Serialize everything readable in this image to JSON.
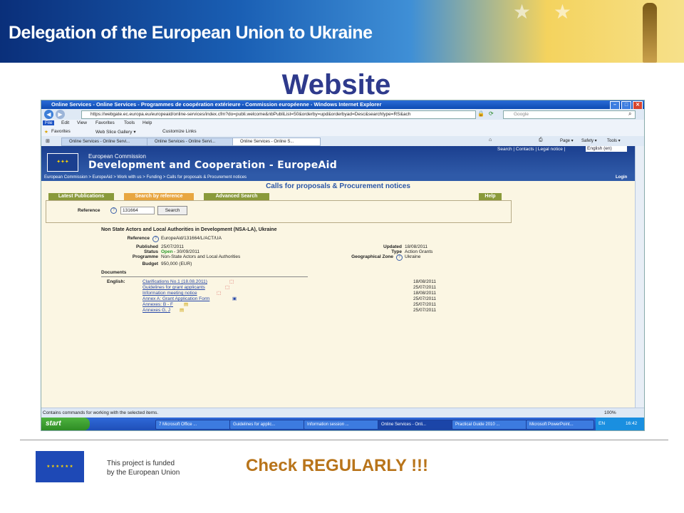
{
  "slide": {
    "banner_title": "Delegation of the European Union to Ukraine",
    "title": "Website",
    "funded_line1": "This project is funded",
    "funded_line2": "by the European Union",
    "callout": "Check REGULARLY !!!"
  },
  "browser": {
    "window_title": "Online Services - Online Services - Programmes de coopération extérieure - Commission européenne - Windows Internet Explorer",
    "url": "https://webgate.ec.europa.eu/europeaid/online-services/index.cfm?do=publi.welcome&nbPubliList=50&orderby=upd&orderbyad=Desc&searchtype=RS&ach",
    "search_placeholder": "Google",
    "menu": [
      "File",
      "Edit",
      "View",
      "Favorites",
      "Tools",
      "Help"
    ],
    "favorites_label": "Favorites",
    "web_slice": "Web Slice Gallery ▾",
    "customize_links": "Customize Links",
    "tabs": [
      "Online Services - Online Servi...",
      "Online Services - Online Servi...",
      "Online Services - Online S..."
    ],
    "commands": [
      "Page ▾",
      "Safety ▾",
      "Tools ▾"
    ],
    "status_text": "Contains commands for working with the selected items.",
    "zoom": "100%"
  },
  "site": {
    "top_links": "Search | Contacts | Legal notice |",
    "language": "English (en)",
    "commission": "European Commission",
    "site_name": "Development and Cooperation - EuropeAid",
    "breadcrumb": "European Commission > EuropeAid > Work with us > Funding > Calls for proposals & Procurement notices",
    "login": "Login",
    "heading": "Calls for proposals & Procurement notices",
    "tabs": [
      "Latest Publications",
      "Search by reference",
      "Advanced Search",
      "Help"
    ],
    "reference_label": "Reference",
    "reference_value": "131664",
    "search_button": "Search"
  },
  "notice": {
    "title": "Non State Actors and Local Authorities in Development (NSA-LA), Ukraine",
    "reference_label": "Reference",
    "reference": "EuropeAid/131664/L/ACT/UA",
    "published_label": "Published",
    "published": "25/07/2011",
    "updated_label": "Updated",
    "updated": "18/08/2011",
    "status_label": "Status",
    "status_open": "Open",
    "status_deadline": "- 30/09/2011",
    "type_label": "Type",
    "type": "Action Grants",
    "programme_label": "Programme",
    "programme": "Non-State Actors and Local Authorities",
    "zone_label": "Geographical Zone",
    "zone": "Ukraine",
    "budget_label": "Budget",
    "budget": "950,000 (EUR)",
    "documents_label": "Documents",
    "language_label": "English:",
    "documents": [
      {
        "name": "Clarifications No.1 (18.08.2011)",
        "date": "18/08/2011"
      },
      {
        "name": "Guidelines for grant applicants",
        "date": "25/07/2011"
      },
      {
        "name": "Information meeting notice",
        "date": "18/08/2011"
      },
      {
        "name": "Annex A: Grant Application Form",
        "date": "25/07/2011"
      },
      {
        "name": "Annexes: B - F",
        "date": "25/07/2011"
      },
      {
        "name": "Annexes G, J",
        "date": "25/07/2011"
      }
    ]
  },
  "taskbar": {
    "start": "start",
    "items": [
      "7 Microsoft Office ...",
      "Guidelines for applic...",
      "Information session ...",
      "Online Services - Onli...",
      "Practical Guide 2010 ...",
      "Microsoft PowerPoint..."
    ],
    "language": "EN",
    "clock": "16:42"
  }
}
